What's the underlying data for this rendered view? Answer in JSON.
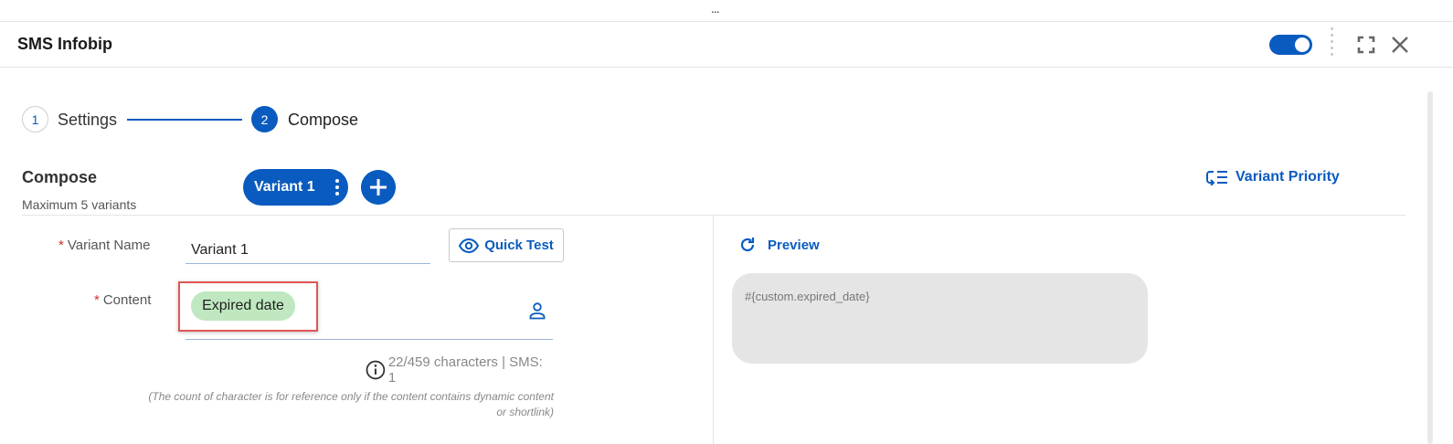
{
  "top_grip": {
    "label": "..."
  },
  "header": {
    "title": "SMS Infobip"
  },
  "stepper": {
    "steps": [
      {
        "number": "1",
        "label": "Settings"
      },
      {
        "number": "2",
        "label": "Compose"
      }
    ]
  },
  "compose": {
    "title": "Compose",
    "subtitle": "Maximum 5 variants",
    "variant_tab": "Variant 1",
    "variant_priority_label": "Variant Priority"
  },
  "form": {
    "required_mark": "*",
    "variant_name_label": "Variant Name",
    "variant_name_value": "Variant 1",
    "quick_test_label": "Quick Test",
    "content_label": "Content",
    "content_chip": "Expired date",
    "char_count": "22/459 characters | SMS: 1",
    "note": "(The count of character is for reference only if the content contains dynamic content or shortlink)"
  },
  "preview": {
    "label": "Preview",
    "text": "#{custom.expired_date}"
  },
  "colors": {
    "accent": "#0a5bbf",
    "chip": "#bfe8c0",
    "highlight": "#e25555",
    "bubble": "#e5e5e5"
  }
}
